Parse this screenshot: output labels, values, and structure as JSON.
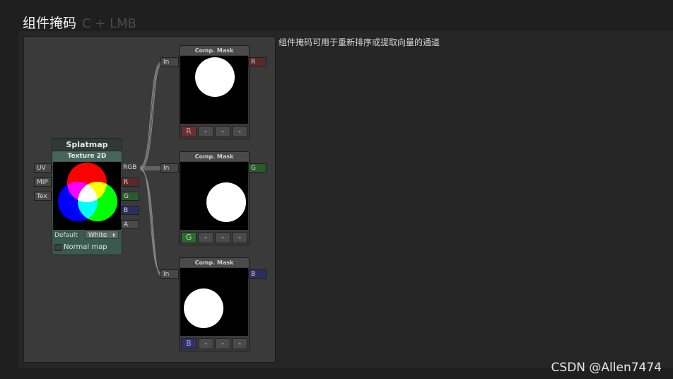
{
  "header": {
    "title": "组件掩码",
    "shortcut": "C + LMB"
  },
  "description": "组件掩码可用于重新排序或提取向量的通道",
  "watermark": "CSDN @Allen7474",
  "splatmap": {
    "title": "Splatmap",
    "subtitle": "Texture 2D",
    "inputs": [
      "UV",
      "MIP",
      "Tex"
    ],
    "outputs": [
      "RGB",
      "R",
      "G",
      "B",
      "A"
    ],
    "default_label": "Default",
    "default_value": "White",
    "select_arrow": "⬍",
    "normal_map_label": "Normal map"
  },
  "masks": [
    {
      "title": "Comp. Mask",
      "input": "In",
      "output": "R",
      "buttons": [
        "R",
        "-",
        "-",
        "-"
      ],
      "mask_shown": "R"
    },
    {
      "title": "Comp. Mask",
      "input": "In",
      "output": "G",
      "buttons": [
        "G",
        "-",
        "-",
        "-"
      ],
      "mask_shown": "G"
    },
    {
      "title": "Comp. Mask",
      "input": "In",
      "output": "B",
      "buttons": [
        "B",
        "-",
        "-",
        "-"
      ],
      "mask_shown": "B"
    }
  ],
  "colors": {
    "red": "#ff0000",
    "green": "#00ff00",
    "blue": "#0000ff",
    "canvas": "#3a3a3a"
  }
}
